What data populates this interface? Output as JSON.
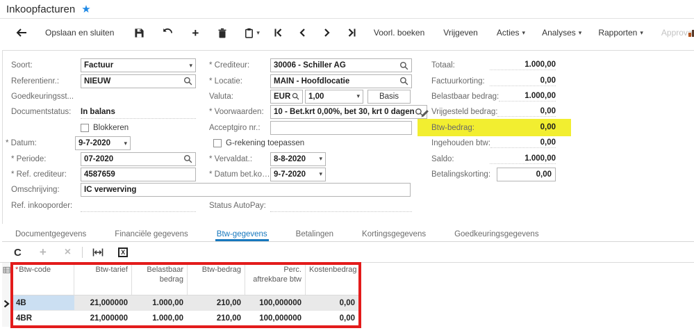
{
  "window": {
    "title": "Inkoopfacturen"
  },
  "toolbar": {
    "save_and_close": "Opslaan en sluiten",
    "voorl_boeken": "Voorl. boeken",
    "vrijgeven": "Vrijgeven",
    "acties": "Acties",
    "analyses": "Analyses",
    "rapporten": "Rapporten",
    "approval": "Approval"
  },
  "form": {
    "left": {
      "soort": {
        "label": "Soort:",
        "value": "Factuur"
      },
      "referentienr": {
        "label": "Referentienr.:",
        "value": "NIEUW"
      },
      "goedkeuringsstatus": {
        "label": "Goedkeuringsst...",
        "value": ""
      },
      "documentstatus": {
        "label": "Documentstatus:",
        "value": "In balans"
      },
      "blokkeren": {
        "label": "Blokkeren"
      },
      "datum": {
        "label": "* Datum:",
        "value": "9-7-2020"
      },
      "periode": {
        "label": "* Periode:",
        "value": "07-2020"
      },
      "ref_crediteur": {
        "label": "* Ref. crediteur:",
        "value": "4587659"
      },
      "omschrijving": {
        "label": "Omschrijving:",
        "value": "IC verwerving"
      },
      "ref_inkooporder": {
        "label": "Ref. inkooporder:",
        "value": ""
      }
    },
    "middle": {
      "crediteur": {
        "label": "* Crediteur:",
        "value": "30006 - Schiller AG"
      },
      "locatie": {
        "label": "* Locatie:",
        "value": "MAIN - Hoofdlocatie"
      },
      "valuta": {
        "label": "Valuta:",
        "code": "EUR",
        "rate": "1,00",
        "basis": "Basis"
      },
      "voorwaarden": {
        "label": "* Voorwaarden:",
        "value": "10 - Bet.krt 0,00%, bet 30, krt 0 dagen"
      },
      "acceptgiro": {
        "label": "Acceptgiro nr.:",
        "value": ""
      },
      "g_rekening": {
        "label": "G-rekening toepassen"
      },
      "vervaldatum": {
        "label": "* Vervaldat.:",
        "value": "8-8-2020"
      },
      "datum_bet_korting": {
        "label": "* Datum bet.korting:",
        "value": "9-7-2020"
      },
      "status_autopay": {
        "label": "Status AutoPay:",
        "value": ""
      }
    },
    "right": {
      "totaal": {
        "label": "Totaal:",
        "value": "1.000,00"
      },
      "factuurkorting": {
        "label": "Factuurkorting:",
        "value": "0,00"
      },
      "belastbaar_bedrag": {
        "label": "Belastbaar bedrag:",
        "value": "1.000,00"
      },
      "vrijgesteld_bedrag": {
        "label": "Vrijgesteld bedrag:",
        "value": "0,00"
      },
      "btw_bedrag": {
        "label": "Btw-bedrag:",
        "value": "0,00"
      },
      "ingehouden_btw": {
        "label": "Ingehouden btw:",
        "value": "0,00"
      },
      "saldo": {
        "label": "Saldo:",
        "value": "1.000,00"
      },
      "betalingskorting": {
        "label": "Betalingskorting:",
        "value": "0,00"
      }
    }
  },
  "tabs": {
    "items": [
      {
        "label": "Documentgegevens"
      },
      {
        "label": "Financiële gegevens"
      },
      {
        "label": "Btw-gegevens"
      },
      {
        "label": "Betalingen"
      },
      {
        "label": "Kortingsgegevens"
      },
      {
        "label": "Goedkeuringsgegevens"
      }
    ],
    "active": "Btw-gegevens"
  },
  "grid": {
    "required_marker": "*",
    "headers": [
      "Btw-code",
      "Btw-tarief",
      "Belastbaar bedrag",
      "Btw-bedrag",
      "Perc. aftrekbare btw",
      "Kostenbedrag"
    ],
    "rows": [
      [
        "4B",
        "21,000000",
        "1.000,00",
        "210,00",
        "100,000000",
        "0,00"
      ],
      [
        "4BR",
        "21,000000",
        "1.000,00",
        "210,00",
        "100,000000",
        "0,00"
      ]
    ]
  },
  "icons": {
    "star": "★",
    "caret_down": "▾",
    "plus": "+",
    "close": "×",
    "refresh": "C",
    "excel": "X"
  },
  "annotations": {
    "highlight_color": "#f2ee30",
    "box_color": "#e31b1b"
  }
}
